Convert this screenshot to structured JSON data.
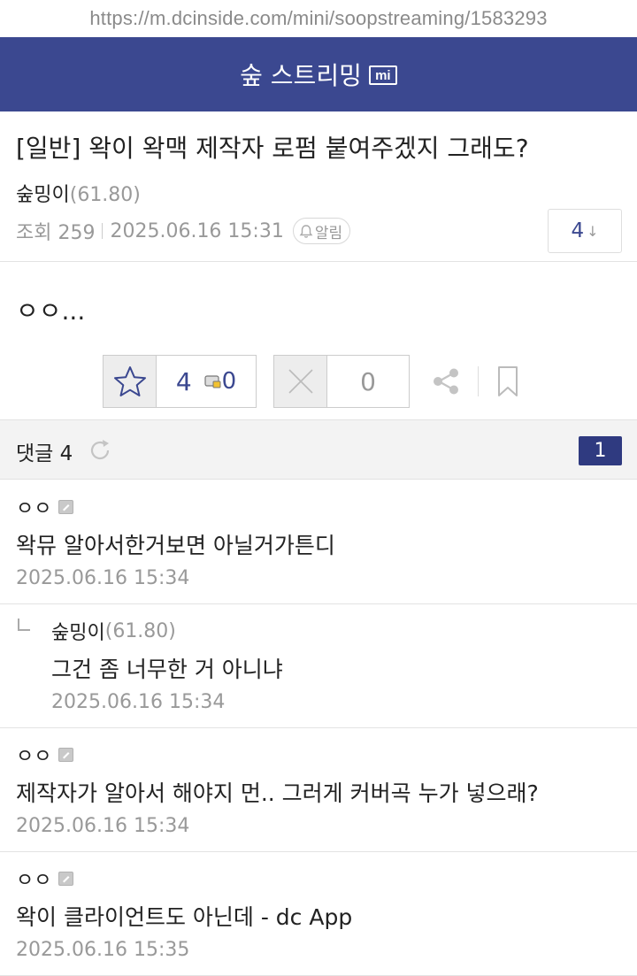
{
  "browser": {
    "url": "https://m.dcinside.com/mini/soopstreaming/1583293"
  },
  "gallery": {
    "title": "숲 스트리밍",
    "badge": "mi"
  },
  "post": {
    "title": "[일반] 왁이 왁맥 제작자 로펌 붙여주겠지 그래도?",
    "author": "숲밍이",
    "author_ip": "(61.80)",
    "views": "조회 259",
    "datetime": "2025.06.16 15:31",
    "alarm_label": "알림",
    "reply_count": "4",
    "reply_arrow": "↓",
    "body": "ㅇㅇ..."
  },
  "votes": {
    "up_count": "4",
    "fix_up_count": "0",
    "down_count": "0"
  },
  "comment_section": {
    "label": "댓글 4",
    "page": "1"
  },
  "comments": [
    {
      "nick": "ㅇㅇ",
      "ip": "",
      "text": "왁뮤 알아서한거보면 아닐거가튼디",
      "date": "2025.06.16 15:34",
      "is_reply": false
    },
    {
      "nick": "숲밍이",
      "ip": "(61.80)",
      "text": "그건 좀 너무한 거 아니냐",
      "date": "2025.06.16 15:34",
      "is_reply": true
    },
    {
      "nick": "ㅇㅇ",
      "ip": "",
      "text": "제작자가 알아서 해야지 먼.. 그러게 커버곡 누가 넣으래?",
      "date": "2025.06.16 15:34",
      "is_reply": false
    },
    {
      "nick": "ㅇㅇ",
      "ip": "",
      "text": "왁이 클라이언트도 아닌데 - dc App",
      "date": "2025.06.16 15:35",
      "is_reply": false
    }
  ],
  "colors": {
    "header_bg": "#3b4890",
    "accent": "#3b4890",
    "page_badge": "#2f3a80",
    "muted": "#999999"
  },
  "icons": [
    "mini-gallery-icon",
    "bell-icon",
    "star-icon",
    "fix-recommend-icon",
    "x-icon",
    "share-icon",
    "bookmark-icon",
    "refresh-icon",
    "fixed-nick-icon"
  ]
}
